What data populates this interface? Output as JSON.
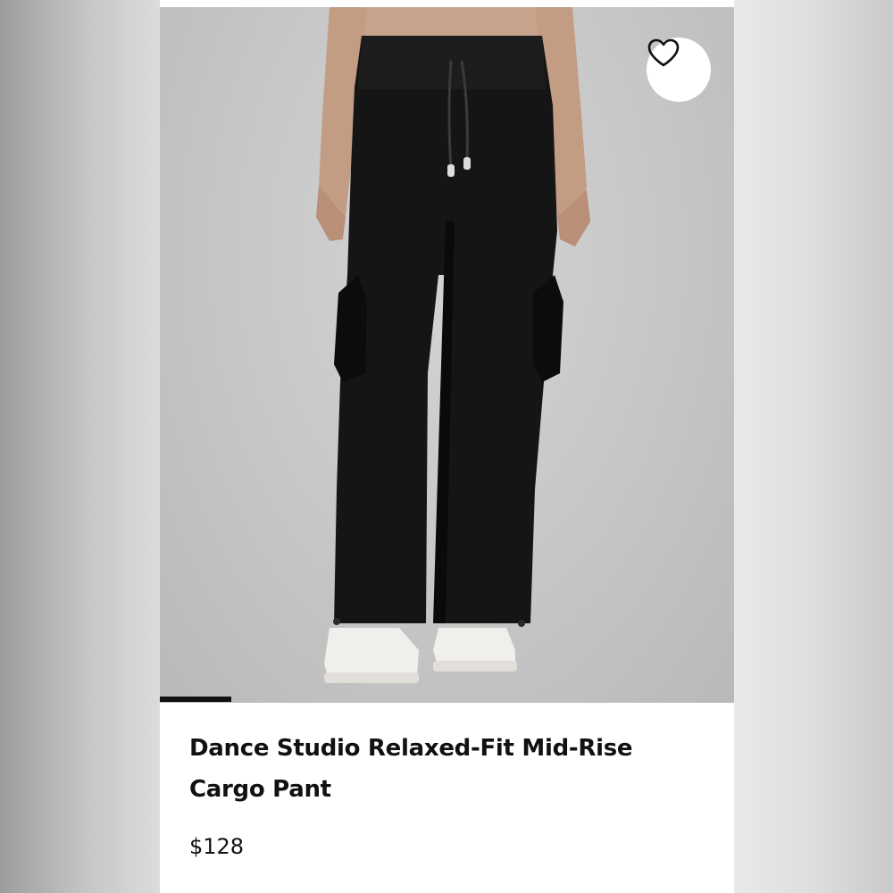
{
  "product": {
    "title": "Dance Studio Relaxed-Fit Mid-Rise Cargo Pant",
    "price": "$128"
  },
  "image": {
    "subject": "product-photo-black-cargo-pants"
  },
  "favorite": {
    "icon": "heart-outline-icon",
    "selected": false
  },
  "carousel": {
    "current_slide": 1
  },
  "colors": {
    "text": "#111111",
    "background": "#ffffff",
    "photo_background": "#c8c8c8",
    "indicator": "#111111"
  }
}
